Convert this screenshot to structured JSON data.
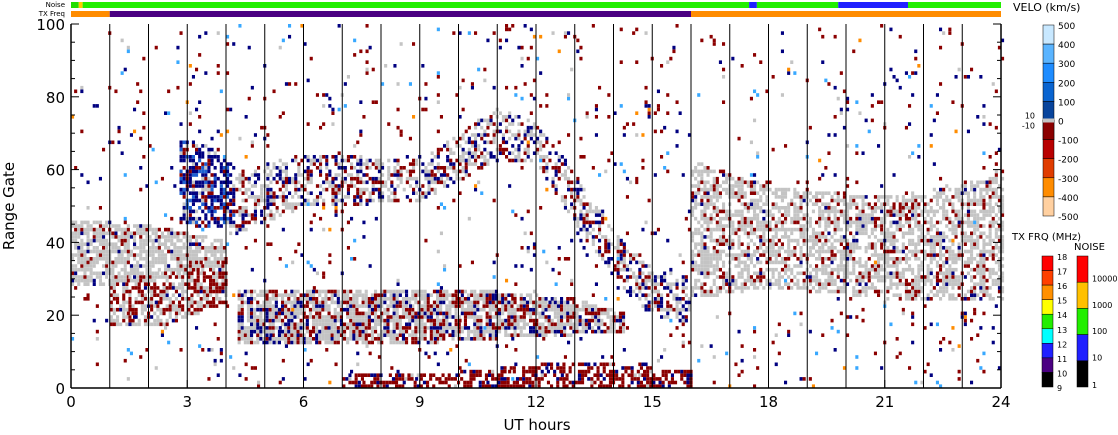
{
  "chart_data": {
    "type": "heatmap",
    "title": "",
    "xlabel": "UT hours",
    "ylabel": "Range Gate",
    "xlim": [
      0,
      24
    ],
    "ylim": [
      0,
      100
    ],
    "xticks": [
      "0",
      "3",
      "6",
      "9",
      "12",
      "15",
      "18",
      "21",
      "24"
    ],
    "yticks": [
      "0",
      "20",
      "40",
      "60",
      "80",
      "100"
    ],
    "grid": "vertical lines every hour",
    "status_bars": {
      "noise_label": "Noise",
      "txfreq_label": "TX Freq",
      "noise_segments": [
        {
          "t0": 0,
          "t1": 0.2,
          "color": "#22dd00"
        },
        {
          "t0": 0.2,
          "t1": 0.3,
          "color": "#ffcc00"
        },
        {
          "t0": 0.3,
          "t1": 16,
          "color": "#22ee00"
        },
        {
          "t0": 16,
          "t1": 17.5,
          "color": "#22ee00"
        },
        {
          "t0": 17.5,
          "t1": 17.7,
          "color": "#2020ff"
        },
        {
          "t0": 17.7,
          "t1": 19.8,
          "color": "#22ee00"
        },
        {
          "t0": 19.8,
          "t1": 21.6,
          "color": "#2020ff"
        },
        {
          "t0": 21.6,
          "t1": 24,
          "color": "#22ee00"
        }
      ],
      "txfreq_segments": [
        {
          "t0": 0,
          "t1": 1,
          "color": "#ff8c00"
        },
        {
          "t0": 1,
          "t1": 16,
          "color": "#4b0082"
        },
        {
          "t0": 16,
          "t1": 24,
          "color": "#ff8c00"
        }
      ]
    },
    "colors": {
      "ground": "#c4c4c4",
      "neg_dark": "#8b0000",
      "neg_mid": "#c00000",
      "pos_dark": "#000080",
      "pos_mid": "#1e5fd0",
      "pos_light": "#38a8ff",
      "orange": "#ff8c00"
    },
    "features": [
      {
        "name": "early-ground-band",
        "times": [
          0,
          2,
          4
        ],
        "lo": [
          28,
          30,
          34
        ],
        "hi": [
          46,
          44,
          40
        ],
        "density": 0.75,
        "mix": {
          "ground": 0.85,
          "neg_dark": 0.1,
          "pos_dark": 0.05
        }
      },
      {
        "name": "early-low-band",
        "times": [
          1,
          2.5,
          4
        ],
        "lo": [
          17,
          18,
          24
        ],
        "hi": [
          30,
          32,
          36
        ],
        "density": 0.7,
        "mix": {
          "ground": 0.5,
          "neg_dark": 0.45,
          "pos_dark": 0.05
        }
      },
      {
        "name": "blue-patch",
        "times": [
          2.8,
          3.5,
          4.2
        ],
        "lo": [
          45,
          44,
          46
        ],
        "hi": [
          68,
          66,
          60
        ],
        "density": 0.7,
        "mix": {
          "pos_dark": 0.6,
          "pos_mid": 0.2,
          "neg_dark": 0.15,
          "ground": 0.05
        }
      },
      {
        "name": "ionospheric-arc",
        "times": [
          4,
          6,
          9,
          11,
          12,
          13,
          14,
          15,
          16
        ],
        "lo": [
          42,
          50,
          52,
          63,
          62,
          45,
          30,
          20,
          18
        ],
        "hi": [
          58,
          64,
          62,
          77,
          72,
          58,
          42,
          32,
          30
        ],
        "density": 0.5,
        "mix": {
          "ground": 0.5,
          "neg_dark": 0.25,
          "pos_dark": 0.25
        }
      },
      {
        "name": "mid-band",
        "times": [
          4.3,
          8,
          11,
          13,
          14.3
        ],
        "lo": [
          12,
          12,
          14,
          15,
          16
        ],
        "hi": [
          27,
          27,
          26,
          24,
          20
        ],
        "density": 0.8,
        "mix": {
          "ground": 0.55,
          "neg_dark": 0.3,
          "pos_dark": 0.15
        }
      },
      {
        "name": "near-range",
        "times": [
          7,
          10,
          13,
          16
        ],
        "lo": [
          0,
          0,
          0,
          0
        ],
        "hi": [
          3,
          4,
          7,
          4
        ],
        "density": 0.6,
        "mix": {
          "neg_dark": 0.8,
          "pos_dark": 0.15,
          "ground": 0.05
        }
      },
      {
        "name": "late-ground-band",
        "times": [
          16,
          18,
          21,
          24
        ],
        "lo": [
          25,
          28,
          25,
          24
        ],
        "hi": [
          62,
          55,
          52,
          58
        ],
        "density": 0.6,
        "mix": {
          "ground": 0.8,
          "neg_dark": 0.17,
          "pos_dark": 0.03
        }
      },
      {
        "name": "scattered",
        "times": [
          0,
          24
        ],
        "lo": [
          0,
          0
        ],
        "hi": [
          100,
          100
        ],
        "density": 0.035,
        "mix": {
          "neg_dark": 0.45,
          "pos_dark": 0.3,
          "ground": 0.1,
          "orange": 0.05,
          "pos_light": 0.1
        }
      }
    ],
    "velocity_scale": {
      "label": "VELO (km/s)",
      "ticks": [
        "500",
        "400",
        "300",
        "200",
        "100",
        "0",
        "-100",
        "-200",
        "-300",
        "-400",
        "-500"
      ],
      "inner_labels": [
        "10",
        "-10"
      ],
      "colors": [
        "#c8e8ff",
        "#5ab4ff",
        "#1e8cff",
        "#0a64d0",
        "#08449c",
        "#000080",
        "#8b0000",
        "#b80000",
        "#e03c00",
        "#ff8c00",
        "#ffd0a0"
      ]
    },
    "txfreq_scale": {
      "label": "TX FRQ (MHz)",
      "ticks": [
        "18",
        "17",
        "16",
        "15",
        "14",
        "13",
        "12",
        "11",
        "10",
        "9"
      ],
      "colors": [
        "#ff0000",
        "#ff4000",
        "#ff9000",
        "#ffff00",
        "#22ee00",
        "#00ffff",
        "#2020ff",
        "#4b0082",
        "#000000"
      ]
    },
    "noise_scale": {
      "label": "NOISE",
      "ticks": [
        "10000",
        "1000",
        "100",
        "10",
        "1"
      ],
      "colors": [
        "#ff0000",
        "#ffc000",
        "#22ee00",
        "#2020ff",
        "#000000"
      ]
    }
  }
}
